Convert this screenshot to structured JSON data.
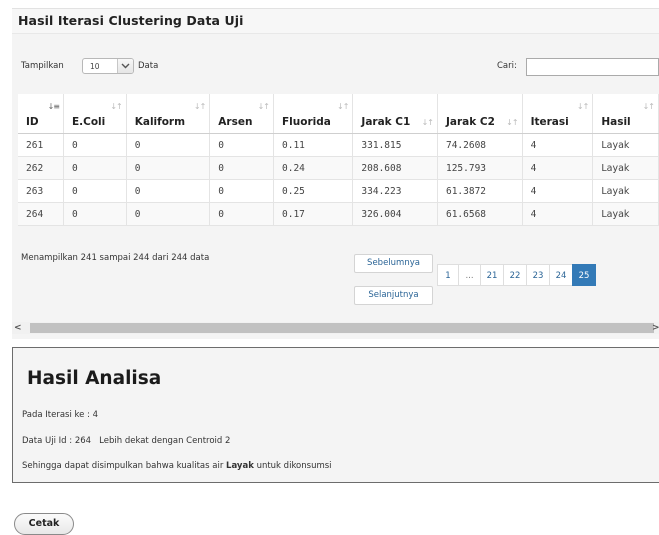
{
  "panel": {
    "title": "Hasil Iterasi Clustering Data Uji"
  },
  "controls": {
    "show_label": "Tampilkan",
    "show_value": "10",
    "show_suffix": "Data",
    "search_label": "Cari:",
    "search_value": ""
  },
  "table": {
    "columns": [
      "ID",
      "E.Coli",
      "Kaliform",
      "Arsen",
      "Fluorida",
      "Jarak C1",
      "Jarak C2",
      "Iterasi",
      "Hasil"
    ],
    "rows": [
      [
        "261",
        "0",
        "0",
        "0",
        "0.11",
        "331.815",
        "74.2608",
        "4",
        "Layak"
      ],
      [
        "262",
        "0",
        "0",
        "0",
        "0.24",
        "208.608",
        "125.793",
        "4",
        "Layak"
      ],
      [
        "263",
        "0",
        "0",
        "0",
        "0.25",
        "334.223",
        "61.3872",
        "4",
        "Layak"
      ],
      [
        "264",
        "0",
        "0",
        "0",
        "0.17",
        "326.004",
        "61.6568",
        "4",
        "Layak"
      ]
    ]
  },
  "footer": {
    "info": "Menampilkan 241 sampai 244 dari 244 data",
    "prev_label": "Sebelumnya",
    "next_label": "Selanjutnya",
    "pages": [
      "1",
      "...",
      "21",
      "22",
      "23",
      "24",
      "25"
    ],
    "active_page": "25"
  },
  "analysis": {
    "title": "Hasil Analisa",
    "iteration_line": "Pada Iterasi ke : 4",
    "data_line_prefix": "Data Uji Id : 264",
    "data_line_suffix": "Lebih dekat dengan Centroid 2",
    "conclusion_prefix": "Sehingga dapat disimpulkan bahwa kualitas air",
    "conclusion_bold": "Layak",
    "conclusion_suffix": "untuk dikonsumsi"
  },
  "actions": {
    "print_label": "Cetak"
  },
  "colors": {
    "accent": "#337ab7",
    "link": "#2a6496"
  }
}
